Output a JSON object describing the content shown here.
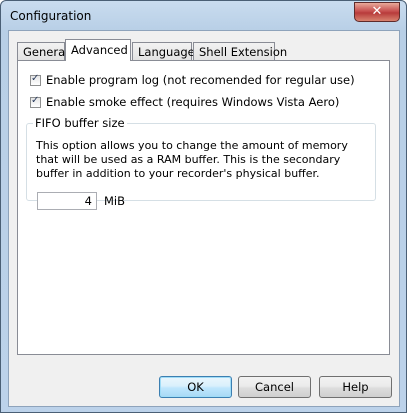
{
  "window": {
    "title": "Configuration",
    "close_glyph": "✕"
  },
  "tabs": [
    {
      "label": "General"
    },
    {
      "label": "Advanced"
    },
    {
      "label": "Language"
    },
    {
      "label": "Shell Extension"
    }
  ],
  "advanced": {
    "enable_log": {
      "label": "Enable program log (not recomended for regular use)",
      "checked": true
    },
    "enable_smoke": {
      "label": "Enable smoke effect (requires Windows Vista Aero)",
      "checked": true
    },
    "fifo": {
      "legend": "FIFO buffer size",
      "description": "This option allows you to change the amount of memory that will be used as a RAM buffer. This is the secondary buffer in addition to your recorder's physical buffer.",
      "value": "4",
      "unit": "MiB"
    }
  },
  "buttons": {
    "ok": "OK",
    "cancel": "Cancel",
    "help": "Help"
  },
  "check_glyph": "✓"
}
